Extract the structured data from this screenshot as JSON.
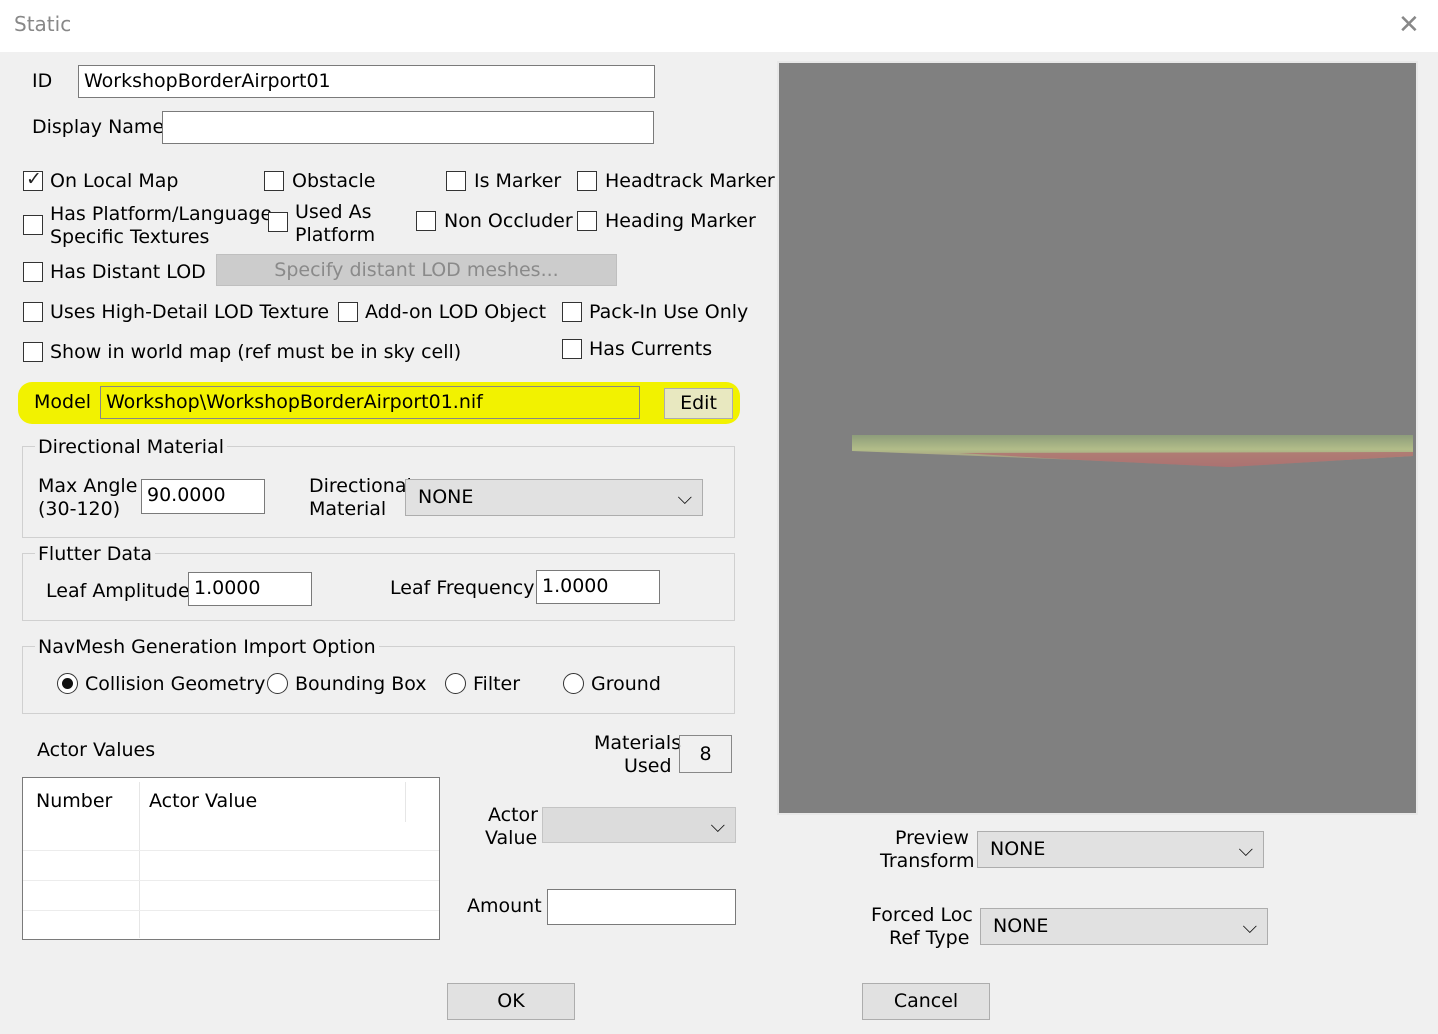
{
  "window": {
    "title": "Static",
    "close_icon": "close-icon"
  },
  "id_label": "ID",
  "id_value": "WorkshopBorderAirport01",
  "display_name_label": "Display Name",
  "display_name_value": "",
  "flags": {
    "on_local_map": {
      "label": "On Local Map",
      "checked": true
    },
    "obstacle": {
      "label": "Obstacle",
      "checked": false
    },
    "is_marker": {
      "label": "Is Marker",
      "checked": false
    },
    "headtrack_marker": {
      "label": "Headtrack Marker",
      "checked": false
    },
    "has_platform_textures": {
      "label_line1": "Has Platform/Language",
      "label_line2": "Specific Textures",
      "checked": false
    },
    "used_as_platform": {
      "label_line1": "Used As",
      "label_line2": "Platform",
      "checked": false
    },
    "non_occluder": {
      "label": "Non Occluder",
      "checked": false
    },
    "heading_marker": {
      "label": "Heading Marker",
      "checked": false
    },
    "has_distant_lod": {
      "label": "Has Distant LOD",
      "checked": false
    },
    "uses_high_detail_lod": {
      "label": "Uses High-Detail LOD Texture",
      "checked": false
    },
    "addon_lod_object": {
      "label": "Add-on LOD Object",
      "checked": false
    },
    "pack_in_use_only": {
      "label": "Pack-In Use Only",
      "checked": false
    },
    "show_in_world_map": {
      "label": "Show in world map (ref must be in sky cell)",
      "checked": false
    },
    "has_currents": {
      "label": "Has Currents",
      "checked": false
    }
  },
  "specify_lod_button": "Specify distant LOD meshes...",
  "model": {
    "label": "Model",
    "value": "Workshop\\WorkshopBorderAirport01.nif",
    "edit_button": "Edit",
    "highlight_color": "#f2f200"
  },
  "directional_material": {
    "group_title": "Directional Material",
    "max_angle_label_line1": "Max Angle",
    "max_angle_label_line2": "(30-120)",
    "max_angle_value": "90.0000",
    "dir_mat_label_line1": "Directional",
    "dir_mat_label_line2": "Material",
    "dir_mat_value": "NONE"
  },
  "flutter": {
    "group_title": "Flutter Data",
    "leaf_amplitude_label": "Leaf Amplitude",
    "leaf_amplitude_value": "1.0000",
    "leaf_frequency_label": "Leaf Frequency",
    "leaf_frequency_value": "1.0000"
  },
  "navmesh": {
    "group_title": "NavMesh Generation Import Option",
    "options": [
      {
        "label": "Collision Geometry",
        "selected": true
      },
      {
        "label": "Bounding Box",
        "selected": false
      },
      {
        "label": "Filter",
        "selected": false
      },
      {
        "label": "Ground",
        "selected": false
      }
    ]
  },
  "actor_values": {
    "label": "Actor Values",
    "columns": [
      "Number",
      "Actor Value"
    ],
    "rows": []
  },
  "materials_used": {
    "label_line1": "Materials",
    "label_line2": "Used",
    "value": "8"
  },
  "actor_value_select": {
    "label_line1": "Actor",
    "label_line2": "Value",
    "value": ""
  },
  "amount": {
    "label": "Amount",
    "value": ""
  },
  "preview_transform": {
    "label_line1": "Preview",
    "label_line2": "Transform",
    "value": "NONE"
  },
  "forced_loc_ref": {
    "label_line1": "Forced Loc",
    "label_line2": "Ref Type",
    "value": "NONE"
  },
  "buttons": {
    "ok": "OK",
    "cancel": "Cancel"
  },
  "colors": {
    "preview_bg": "#808080"
  }
}
